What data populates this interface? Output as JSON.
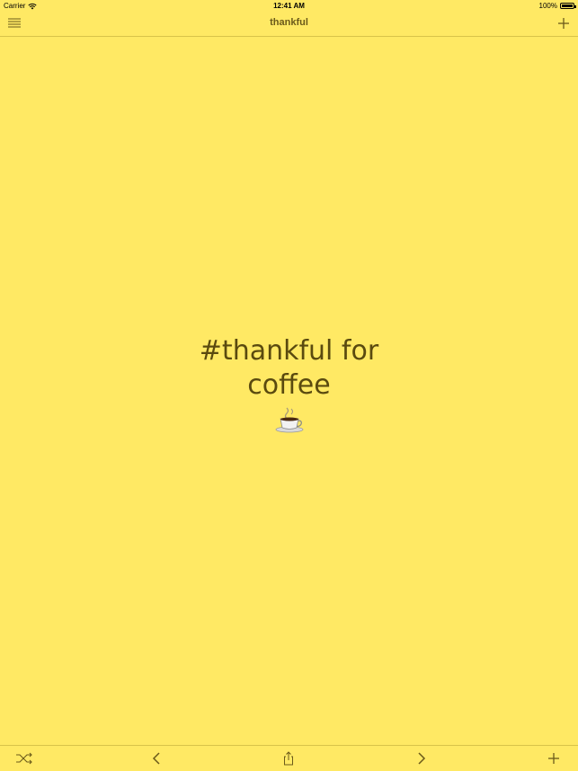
{
  "status_bar": {
    "carrier": "Carrier",
    "time": "12:41 AM",
    "battery": "100%",
    "battery_level": 1.0
  },
  "nav": {
    "title": "thankful",
    "menu_icon": "hamburger-menu-icon",
    "add_icon": "plus-icon"
  },
  "card": {
    "line1": "#thankful for",
    "line2": "coffee",
    "emoji": "coffee-cup-emoji"
  },
  "toolbar": {
    "shuffle_icon": "shuffle-icon",
    "previous_icon": "chevron-left-icon",
    "share_icon": "share-icon",
    "next_icon": "chevron-right-icon",
    "add_icon": "plus-icon"
  },
  "colors": {
    "background": "#FFE964",
    "accent": "#6b5a1a",
    "divider": "#d8c34a"
  }
}
